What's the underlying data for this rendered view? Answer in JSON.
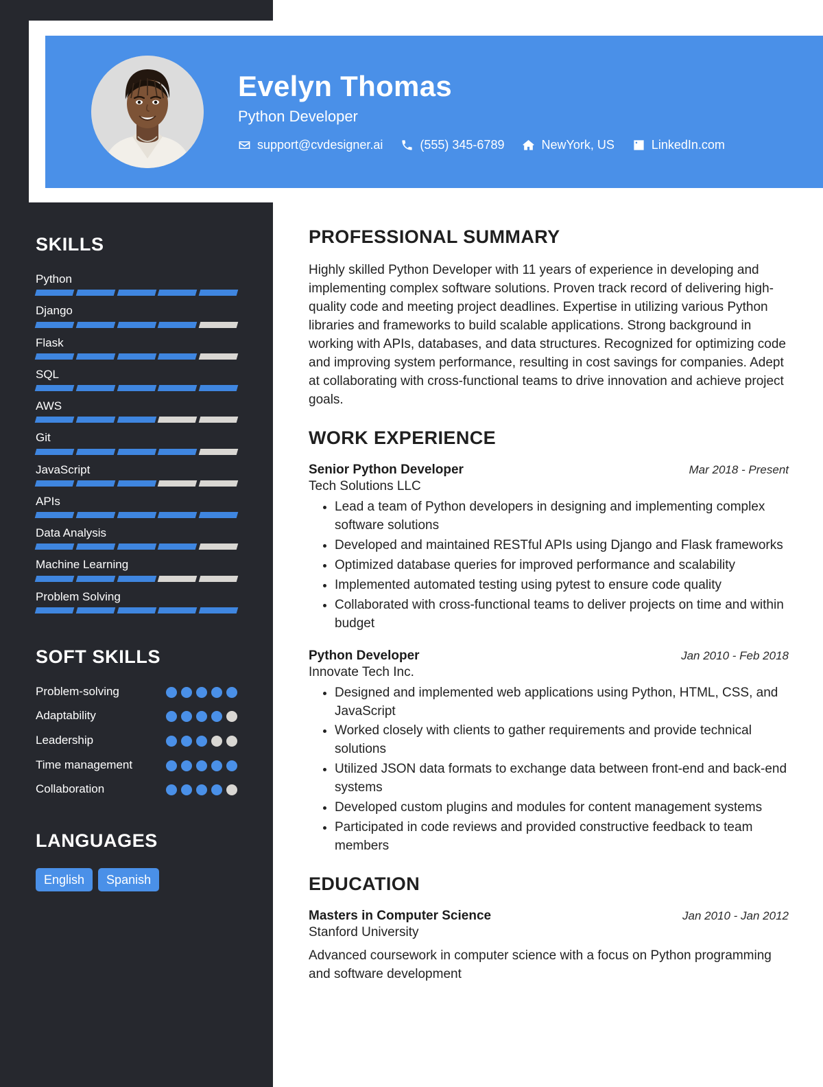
{
  "theme": {
    "accent": "#4a90e8",
    "sidebar_bg": "#26282e",
    "bar_empty": "#d9d7d3",
    "bar_full": "#3f86e0",
    "page_bg": "#ffffff"
  },
  "header": {
    "name": "Evelyn Thomas",
    "role": "Python Developer",
    "avatar_alt": "profile-photo",
    "contacts": [
      {
        "icon": "envelope-icon",
        "text": "support@cvdesigner.ai"
      },
      {
        "icon": "phone-icon",
        "text": "(555) 345-6789"
      },
      {
        "icon": "home-icon",
        "text": "NewYork, US"
      },
      {
        "icon": "linkedin-icon",
        "text": "LinkedIn.com"
      }
    ]
  },
  "sidebar": {
    "skills": {
      "title": "SKILLS",
      "total_segments": 5,
      "items": [
        {
          "label": "Python",
          "level": 5
        },
        {
          "label": "Django",
          "level": 4
        },
        {
          "label": "Flask",
          "level": 4
        },
        {
          "label": "SQL",
          "level": 5
        },
        {
          "label": "AWS",
          "level": 3
        },
        {
          "label": "Git",
          "level": 4
        },
        {
          "label": "JavaScript",
          "level": 3
        },
        {
          "label": "APIs",
          "level": 5
        },
        {
          "label": "Data Analysis",
          "level": 4
        },
        {
          "label": "Machine Learning",
          "level": 3
        },
        {
          "label": "Problem Solving",
          "level": 5
        }
      ]
    },
    "soft_skills": {
      "title": "SOFT SKILLS",
      "total_dots": 5,
      "items": [
        {
          "label": "Problem-solving",
          "level": 5
        },
        {
          "label": "Adaptability",
          "level": 4
        },
        {
          "label": "Leadership",
          "level": 3
        },
        {
          "label": "Time management",
          "level": 5
        },
        {
          "label": "Collaboration",
          "level": 4
        }
      ]
    },
    "languages": {
      "title": "LANGUAGES",
      "items": [
        "English",
        "Spanish"
      ]
    }
  },
  "main": {
    "summary": {
      "title": "PROFESSIONAL SUMMARY",
      "text": "Highly skilled Python Developer with 11 years of experience in developing and implementing complex software solutions. Proven track record of delivering high-quality code and meeting project deadlines. Expertise in utilizing various Python libraries and frameworks to build scalable applications. Strong background in working with APIs, databases, and data structures. Recognized for optimizing code and improving system performance, resulting in cost savings for companies. Adept at collaborating with cross-functional teams to drive innovation and achieve project goals."
    },
    "work_experience": {
      "title": "WORK EXPERIENCE",
      "entries": [
        {
          "title": "Senior Python Developer",
          "date": "Mar 2018 - Present",
          "organization": "Tech Solutions LLC",
          "bullets": [
            "Lead a team of Python developers in designing and implementing complex software solutions",
            "Developed and maintained RESTful APIs using Django and Flask frameworks",
            "Optimized database queries for improved performance and scalability",
            "Implemented automated testing using pytest to ensure code quality",
            "Collaborated with cross-functional teams to deliver projects on time and within budget"
          ]
        },
        {
          "title": "Python Developer",
          "date": "Jan 2010 - Feb 2018",
          "organization": "Innovate Tech Inc.",
          "bullets": [
            "Designed and implemented web applications using Python, HTML, CSS, and JavaScript",
            "Worked closely with clients to gather requirements and provide technical solutions",
            "Utilized JSON data formats to exchange data between front-end and back-end systems",
            "Developed custom plugins and modules for content management systems",
            "Participated in code reviews and provided constructive feedback to team members"
          ]
        }
      ]
    },
    "education": {
      "title": "EDUCATION",
      "entries": [
        {
          "title": "Masters in Computer Science",
          "date": "Jan 2010 - Jan 2012",
          "organization": "Stanford University",
          "description": "Advanced coursework in computer science with a focus on Python programming and software development"
        }
      ]
    }
  }
}
